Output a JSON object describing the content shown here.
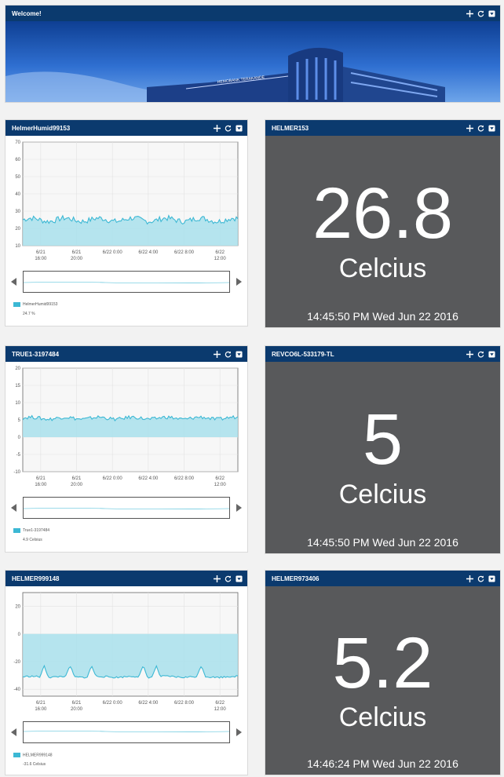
{
  "welcome": {
    "title": "Welcome!"
  },
  "banner": {
    "building_sign": "HEMOBANK TERAKANDE"
  },
  "colors": {
    "header": "#0b3a6e",
    "readout_bg": "#58595b",
    "series": "#3cb8d4",
    "fill": "#a9e0ec"
  },
  "charts": [
    {
      "title": "HelmerHumid99153",
      "y_ticks": [
        "70",
        "60",
        "50",
        "40",
        "30",
        "20",
        "10"
      ],
      "x_ticks": [
        [
          "6/21",
          "16:00"
        ],
        [
          "6/21",
          "20:00"
        ],
        [
          "6/22 0:00",
          ""
        ],
        [
          "6/22 4:00",
          ""
        ],
        [
          "6/22 8:00",
          ""
        ],
        [
          "6/22",
          "12:00"
        ]
      ],
      "legend_name": "HelmerHumid99153",
      "legend_value": "24.7 %",
      "chart_data": {
        "type": "area",
        "ylim": [
          10,
          70
        ],
        "baseline": 10,
        "level": 25,
        "noise": 1.6,
        "spikes": []
      }
    },
    {
      "title": "TRUE1-3197484",
      "y_ticks": [
        "20",
        "15",
        "10",
        "5",
        "0",
        "-5",
        "-10"
      ],
      "x_ticks": [
        [
          "6/21",
          "16:00"
        ],
        [
          "6/21",
          "20:00"
        ],
        [
          "6/22 0:00",
          ""
        ],
        [
          "6/22 4:00",
          ""
        ],
        [
          "6/22 8:00",
          ""
        ],
        [
          "6/22",
          "12:00"
        ]
      ],
      "legend_name": "True1-3197484",
      "legend_value": "4.9 Celsius",
      "chart_data": {
        "type": "area",
        "ylim": [
          -10,
          20
        ],
        "baseline": 0,
        "level": 5.5,
        "noise": 0.5,
        "spikes": []
      }
    },
    {
      "title": "HELMER999148",
      "y_ticks": [
        "20",
        "0",
        "-20",
        "-40"
      ],
      "x_ticks": [
        [
          "6/21",
          "16:00"
        ],
        [
          "6/21",
          "20:00"
        ],
        [
          "6/22 0:00",
          ""
        ],
        [
          "6/22 4:00",
          ""
        ],
        [
          "6/22 8:00",
          ""
        ],
        [
          "6/22",
          "12:00"
        ]
      ],
      "legend_name": "HELMER999148",
      "legend_value": "-31.6 Celsius",
      "chart_data": {
        "type": "area",
        "ylim": [
          -45,
          30
        ],
        "baseline": 0,
        "level": -31,
        "noise": 0.6,
        "spikes": [
          0.1,
          0.22,
          0.32,
          0.56,
          0.62,
          0.83
        ]
      }
    }
  ],
  "readouts": [
    {
      "title": "HELMER153",
      "value": "26.8",
      "unit": "Celcius",
      "timestamp": "14:45:50 PM Wed Jun 22 2016"
    },
    {
      "title": "REVCO6L-533179-TL",
      "value": "5",
      "unit": "Celcius",
      "timestamp": "14:45:50 PM Wed Jun 22 2016"
    },
    {
      "title": "HELMER973406",
      "value": "5.2",
      "unit": "Celcius",
      "timestamp": "14:46:24 PM Wed Jun 22 2016"
    }
  ]
}
